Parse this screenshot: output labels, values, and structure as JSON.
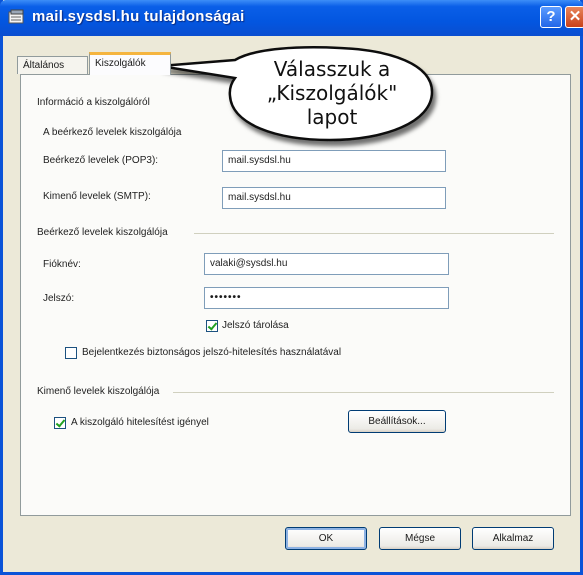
{
  "window": {
    "title": "mail.sysdsl.hu tulajdonságai",
    "help_glyph": "?",
    "close_glyph": "✕"
  },
  "tabs": [
    {
      "label": "Általános",
      "active": false
    },
    {
      "label": "Kiszolgálók",
      "active": true
    }
  ],
  "callout": {
    "line1": "Válasszuk a",
    "line2": "„Kiszolgálók\"",
    "line3": "lapot"
  },
  "server_info": {
    "heading": "Információ a kiszolgálóról",
    "incoming_type_label": "A beérkező levelek kiszolgálója",
    "incoming_label": "Beérkező levelek (POP3):",
    "incoming_value": "mail.sysdsl.hu",
    "outgoing_label": "Kimenő levelek (SMTP):",
    "outgoing_value": "mail.sysdsl.hu"
  },
  "incoming_server": {
    "heading": "Beérkező levelek kiszolgálója",
    "account_label": "Fióknév:",
    "account_value": "valaki@sysdsl.hu",
    "password_label": "Jelszó:",
    "password_value": "•••••••",
    "remember_label": "Jelszó tárolása",
    "remember_checked": true,
    "spa_label": "Bejelentkezés biztonságos jelszó-hitelesítés használatával",
    "spa_checked": false
  },
  "outgoing_server": {
    "heading": "Kimenő levelek kiszolgálója",
    "auth_label": "A kiszolgáló hitelesítést igényel",
    "auth_checked": true,
    "settings_button": "Beállítások..."
  },
  "buttons": {
    "ok": "OK",
    "cancel": "Mégse",
    "apply": "Alkalmaz"
  },
  "colors": {
    "titlebar": "#0a5fe8",
    "dialog_bg": "#ece9d8",
    "tab_accent": "#f5b53f"
  }
}
